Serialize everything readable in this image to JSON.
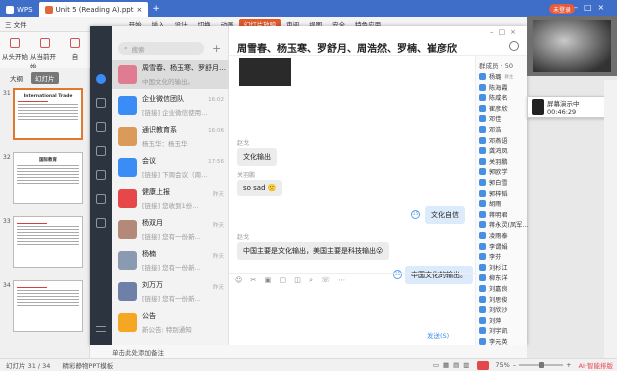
{
  "titlebar": {
    "tabs": [
      {
        "label": "WPS",
        "icon": "wps-logo-icon"
      },
      {
        "label": "Unit 5 (Reading A).ppt",
        "icon": "ppt-file-icon"
      }
    ],
    "signin_label": "未登录"
  },
  "menubar": {
    "file_label": "三 文件",
    "items": [
      "开始",
      "插入",
      "设计",
      "切换",
      "动画",
      "幻灯片放映",
      "审阅",
      "视图",
      "安全",
      "特色应用"
    ],
    "selected": "幻灯片放映"
  },
  "toolbar": {
    "buttons": [
      "从头开始",
      "从当前开始",
      "自"
    ]
  },
  "slidepane": {
    "tabs": [
      "大纲",
      "幻灯片"
    ],
    "active_tab": "幻灯片",
    "slides": [
      {
        "num": "31",
        "title": "International Trade"
      },
      {
        "num": "32",
        "title": "国际教育"
      },
      {
        "num": "33",
        "title": ""
      },
      {
        "num": "34",
        "title": ""
      }
    ]
  },
  "chat": {
    "search_placeholder": "搜索",
    "conversations": [
      {
        "name": "周雪春、杨玉寒、罗舒月…",
        "msg": "中国文化的输出。",
        "time": "",
        "avatar_color": "#e07b91"
      },
      {
        "name": "企业微信团队",
        "msg": "[链接] 企业微信使用...",
        "time": "16:02",
        "avatar_color": "#3b8df5"
      },
      {
        "name": "通识教育系",
        "msg": "杨玉华：杨玉华",
        "time": "16:06",
        "avatar_color": "#d99a5a"
      },
      {
        "name": "会议",
        "msg": "[链接] 下周会议（周...",
        "time": "17:56",
        "avatar_color": "#3b8df5"
      },
      {
        "name": "健康上报",
        "msg": "[链接] 您收到1份...",
        "time": "昨天",
        "avatar_color": "#e5474b"
      },
      {
        "name": "杨双月",
        "msg": "[链接] 您有一份新...",
        "time": "昨天",
        "avatar_color": "#b38a7a"
      },
      {
        "name": "杨楠",
        "msg": "[链接] 您有一份新...",
        "time": "昨天",
        "avatar_color": "#8a9ab0"
      },
      {
        "name": "刘万万",
        "msg": "[链接] 您有一份新...",
        "time": "昨天",
        "avatar_color": "#6e7fa8"
      },
      {
        "name": "公告",
        "msg": "新公告: 特别通知",
        "time": "",
        "avatar_color": "#f5a623"
      }
    ],
    "active_conversation": 0,
    "header_title": "周雪春、杨玉寒、罗舒月、周浩然、罗楠、崔彦欣",
    "messages": [
      {
        "sender": "赵戈",
        "text": "文化输出",
        "side": "left"
      },
      {
        "sender": "关羽鹏",
        "text": "so sad 🙁",
        "side": "left"
      },
      {
        "sender": "",
        "text": "文化自信",
        "side": "right",
        "badge": "15"
      },
      {
        "sender": "赵戈",
        "text": "中国主要是文化输出，美国主要是科技输出😮",
        "side": "left"
      },
      {
        "sender": "",
        "text": "中国文化的输出。",
        "side": "right",
        "badge": "15"
      }
    ],
    "send_label": "发送(S)",
    "members_header": "群成员 · 50",
    "members": [
      {
        "name": "杨璐",
        "role": "群主"
      },
      {
        "name": "陈海霞",
        "role": ""
      },
      {
        "name": "陈咸名",
        "role": ""
      },
      {
        "name": "崔彦欣",
        "role": ""
      },
      {
        "name": "邓佳",
        "role": ""
      },
      {
        "name": "邓浩",
        "role": ""
      },
      {
        "name": "邓燕语",
        "role": ""
      },
      {
        "name": "龚鸿凤",
        "role": ""
      },
      {
        "name": "关羽鹏",
        "role": ""
      },
      {
        "name": "郭欧学",
        "role": ""
      },
      {
        "name": "郭白雪",
        "role": ""
      },
      {
        "name": "郭梓韬",
        "role": ""
      },
      {
        "name": "胡雨",
        "role": ""
      },
      {
        "name": "蒋明君",
        "role": ""
      },
      {
        "name": "蒋永灵(凤军...",
        "role": ""
      },
      {
        "name": "凌雨泰",
        "role": ""
      },
      {
        "name": "李谓娟",
        "role": ""
      },
      {
        "name": "李芬",
        "role": ""
      },
      {
        "name": "刘杉江",
        "role": ""
      },
      {
        "name": "柳东洋",
        "role": ""
      },
      {
        "name": "刘嘉良",
        "role": ""
      },
      {
        "name": "刘思俊",
        "role": ""
      },
      {
        "name": "刘欣沙",
        "role": ""
      },
      {
        "name": "刘萍",
        "role": ""
      },
      {
        "name": "刘宇凯",
        "role": ""
      },
      {
        "name": "李元英",
        "role": ""
      }
    ]
  },
  "recording": {
    "label": "屏幕演示中",
    "time": "00:46:29"
  },
  "notes_placeholder": "单击此处添加备注",
  "statusbar": {
    "slide_info": "幻灯片 31 / 34",
    "template": "精彩静物PPT模板",
    "zoom": "75%",
    "ai_label": "AI·智能排版"
  }
}
